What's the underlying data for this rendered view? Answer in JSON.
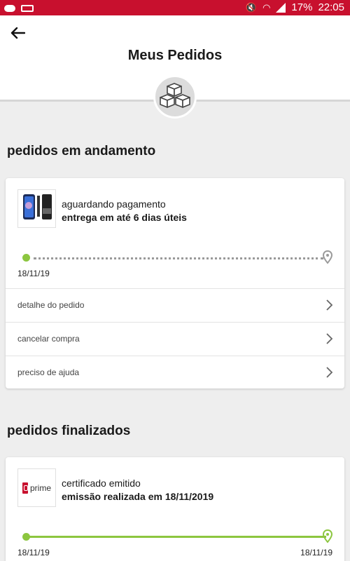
{
  "statusbar": {
    "battery": "17%",
    "time": "22:05"
  },
  "header": {
    "title": "Meus Pedidos"
  },
  "in_progress": {
    "section_title": "pedidos em andamento",
    "order": {
      "status": "aguardando pagamento",
      "delivery": "entrega em até 6 dias úteis",
      "start_date": "18/11/19",
      "progress_fraction": 0
    },
    "menu": [
      {
        "label": "detalhe do pedido"
      },
      {
        "label": "cancelar compra"
      },
      {
        "label": "preciso de ajuda"
      }
    ]
  },
  "finished": {
    "section_title": "pedidos finalizados",
    "order": {
      "status": "certificado emitido",
      "sub": "emissão realizada em 18/11/2019",
      "logo_text": "prime",
      "start_date": "18/11/19",
      "end_date": "18/11/19",
      "progress_fraction": 1
    }
  },
  "colors": {
    "brand_red": "#c8102e",
    "progress_green": "#8cc63f"
  }
}
